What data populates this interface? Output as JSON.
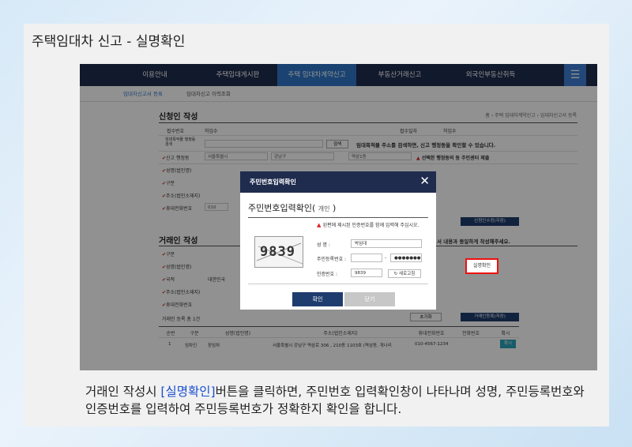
{
  "slide_title": "주택임대차 신고 - 실명확인",
  "nav": {
    "items": [
      "이용안내",
      "주택임대게시판",
      "주택 임대차계약신고",
      "부동산거래신고",
      "외국인부동산취득"
    ],
    "active_index": 2
  },
  "subnav": {
    "items": [
      "임대차신고서 등록",
      "임대차신고 이력조회"
    ]
  },
  "applicant_section": {
    "title": "신청인 작성",
    "breadcrumb": "홈 › 주택 임대차계약신고 › 임대차신고서 등록",
    "receipt_no_label": "접수번호",
    "receipt_no_value": "허임수",
    "receipt_date_label": "접수일자",
    "receipt_date_value": "허임수",
    "address_search_label": "임대목적물 행정동 검색",
    "search_button": "검색",
    "address_hint": "임대목적물 주소를 검색하면, 신고 행정동을 확인할 수 있습니다.",
    "district_label": "신고 행정동",
    "district_values": [
      "서울특별시",
      "강남구",
      "역삼1동"
    ],
    "district_warn": "선택한 행정동의 동 주민센터 제출",
    "name_label": "성명(법인명)",
    "type_label": "구분",
    "address_label": "주소(법인소재지)",
    "phone_label": "휴대전화번호",
    "phone_prefix": "010",
    "confirm_button": "신청인수정(저장)"
  },
  "lessor_section": {
    "title": "거래인 작성",
    "note": "서 내용과 동일하게 작성해주세요.",
    "type_label": "구분",
    "name_label": "성명(법인명)",
    "nation_label": "국적",
    "nation_value": "대한민국",
    "address_label": "주소(법인소재지)",
    "phone_label": "휴대전화번호",
    "realname_button": "실명확인",
    "list_title": "거래인 등록 총 1건",
    "add_button": "거래인등록(저장)",
    "reset_button": "초기화"
  },
  "table": {
    "headers": [
      "순번",
      "구분",
      "성명(법인명)",
      "주소(법인소재지)",
      "휴대전화번호",
      "전화번호",
      "확시"
    ],
    "rows": [
      [
        "1",
        "임차인",
        "장임차",
        "서울특별시 강남구 역삼로 306 , 210동 1103호 (역삼동, 개나리",
        "010-4567-1234",
        "",
        "확시"
      ]
    ]
  },
  "modal": {
    "title": "주민번호입력확인",
    "subtitle": "주민번호입력확인",
    "subtitle_type": "개인",
    "warning": "왼편에 제시된 인증번호를 함께 입력해 주십시오.",
    "name_label": "성    명 :",
    "name_value": "박임대",
    "rrn_label": "주민등록번호 :",
    "rrn_back": "●●●●●●●",
    "auth_label": "인증번호 :",
    "auth_value": "9839",
    "captcha_text": "9839",
    "refresh_label": "새로고침",
    "ok_label": "확인",
    "cancel_label": "닫기"
  },
  "caption": {
    "part1": "거래인 작성시 ",
    "highlight": "[실명확인]",
    "part2": "버튼을 클릭하면, 주민번호 입력확인창이 나타나며 성명, 주민등록번호와 인증번호를 입력하여 주민등록번호가 정확한지 확인을 합니다."
  },
  "colors": {
    "nav_bg": "#1f2c4e",
    "nav_active": "#2f77c9",
    "highlight_red": "#e11111",
    "caption_highlight": "#1a4fd0"
  }
}
